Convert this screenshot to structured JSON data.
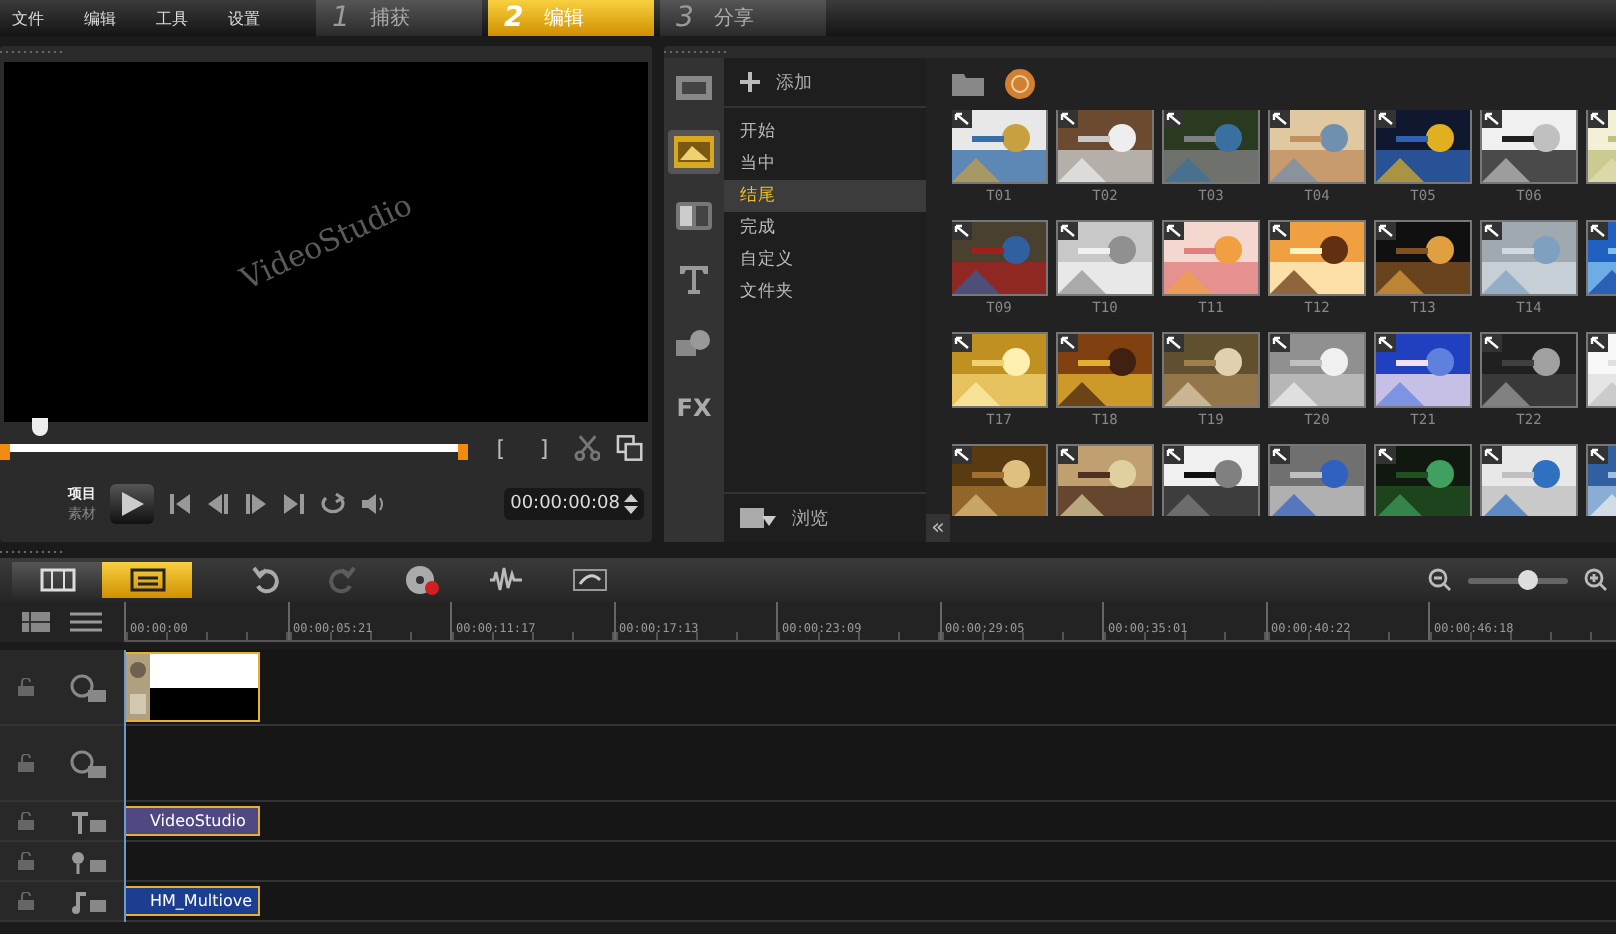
{
  "menu": [
    "文件",
    "编辑",
    "工具",
    "设置"
  ],
  "steps": [
    {
      "number": "1",
      "label": "捕获",
      "selected": false
    },
    {
      "number": "2",
      "label": "编辑",
      "selected": true
    },
    {
      "number": "3",
      "label": "分享",
      "selected": false
    }
  ],
  "preview": {
    "watermark": "VideoStudio",
    "scrubber": {
      "level": 0.07
    },
    "mark_in": "[",
    "mark_out": "]",
    "modes": [
      {
        "label": "项目",
        "selected": true
      },
      {
        "label": "素材",
        "selected": false
      }
    ],
    "timecode": "00:00:00:08"
  },
  "library": {
    "tabs": [
      {
        "kind": "media",
        "selected": false
      },
      {
        "kind": "transition",
        "selected": true
      },
      {
        "kind": "title",
        "selected": false
      },
      {
        "kind": "text",
        "selected": false
      },
      {
        "kind": "graphic",
        "selected": false
      },
      {
        "kind": "fx",
        "label": "FX",
        "selected": false
      }
    ],
    "add_label": "添加",
    "categories": [
      {
        "label": "开始",
        "selected": false
      },
      {
        "label": "当中",
        "selected": false
      },
      {
        "label": "结尾",
        "selected": true
      },
      {
        "label": "完成",
        "selected": false
      },
      {
        "label": "自定义",
        "selected": false
      },
      {
        "label": "文件夹",
        "selected": false
      }
    ],
    "browse_label": "浏览",
    "collapse": "«",
    "thumbnail_rows": [
      {
        "labels": [
          "T01",
          "T02",
          "T03",
          "T04",
          "T05",
          "T06"
        ]
      },
      {
        "labels": [
          "T09",
          "T10",
          "T11",
          "T12",
          "T13",
          "T14"
        ]
      },
      {
        "labels": [
          "T17",
          "T18",
          "T19",
          "T20",
          "T21",
          "T22"
        ]
      },
      {
        "labels": []
      }
    ]
  },
  "timeline": {
    "views": [
      {
        "kind": "storyboard",
        "selected": false
      },
      {
        "kind": "timeline",
        "selected": true
      }
    ],
    "tools": [
      {
        "kind": "undo",
        "disabled": false
      },
      {
        "kind": "redo",
        "disabled": true
      },
      {
        "kind": "record",
        "disabled": false
      },
      {
        "kind": "mixer",
        "disabled": false
      },
      {
        "kind": "music",
        "disabled": false
      }
    ],
    "zoom": {
      "level": 0.6
    },
    "ruler": [
      "00:00:00",
      "00:00:05:21",
      "00:00:11:17",
      "00:00:17:13",
      "00:00:23:09",
      "00:00:29:05",
      "00:00:35:01",
      "00:00:40:22",
      "00:00:46:18"
    ],
    "tracks": [
      {
        "kind": "video"
      },
      {
        "kind": "overlay"
      },
      {
        "kind": "title",
        "clip": "VideoStudio"
      },
      {
        "kind": "voice"
      },
      {
        "kind": "music",
        "clip": "HM_Multiove"
      }
    ]
  }
}
